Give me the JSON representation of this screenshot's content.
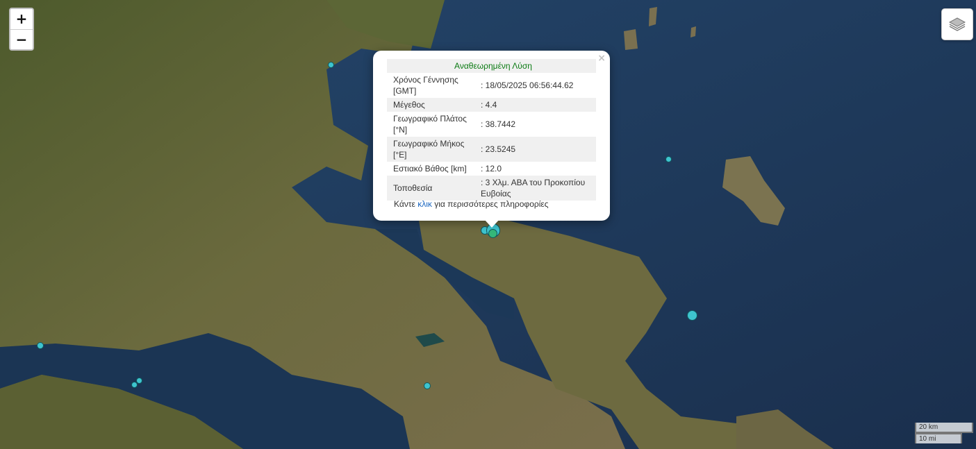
{
  "zoom": {
    "in_label": "+",
    "out_label": "−"
  },
  "layers_icon": "layers-icon",
  "popup": {
    "title": "Αναθεωρημένη Λύση",
    "close": "×",
    "rows": [
      {
        "label": "Χρόνος Γέννησης [GMT]",
        "value": ": 18/05/2025 06:56:44.62"
      },
      {
        "label": "Μέγεθος",
        "value": ": 4.4"
      },
      {
        "label": "Γεωγραφικό Πλάτος [°N]",
        "value": ": 38.7442"
      },
      {
        "label": "Γεωγραφικό Μήκος [°E]",
        "value": ": 23.5245"
      },
      {
        "label": "Εστιακό Βάθος [km]",
        "value": ": 12.0"
      },
      {
        "label": "Τοποθεσία",
        "value": ": 3 Χλμ. ΑΒΑ του Προκοπίου Ευβοίας"
      }
    ],
    "more_prefix": "Κάντε ",
    "more_link": "κλικ",
    "more_suffix": " για περισσότερες πληροφορίες"
  },
  "scale": {
    "km": "20 km",
    "mi": "10 mi"
  },
  "colors": {
    "marker": "#3ec4cf",
    "title": "#0a7a12",
    "link": "#1a66c0"
  }
}
